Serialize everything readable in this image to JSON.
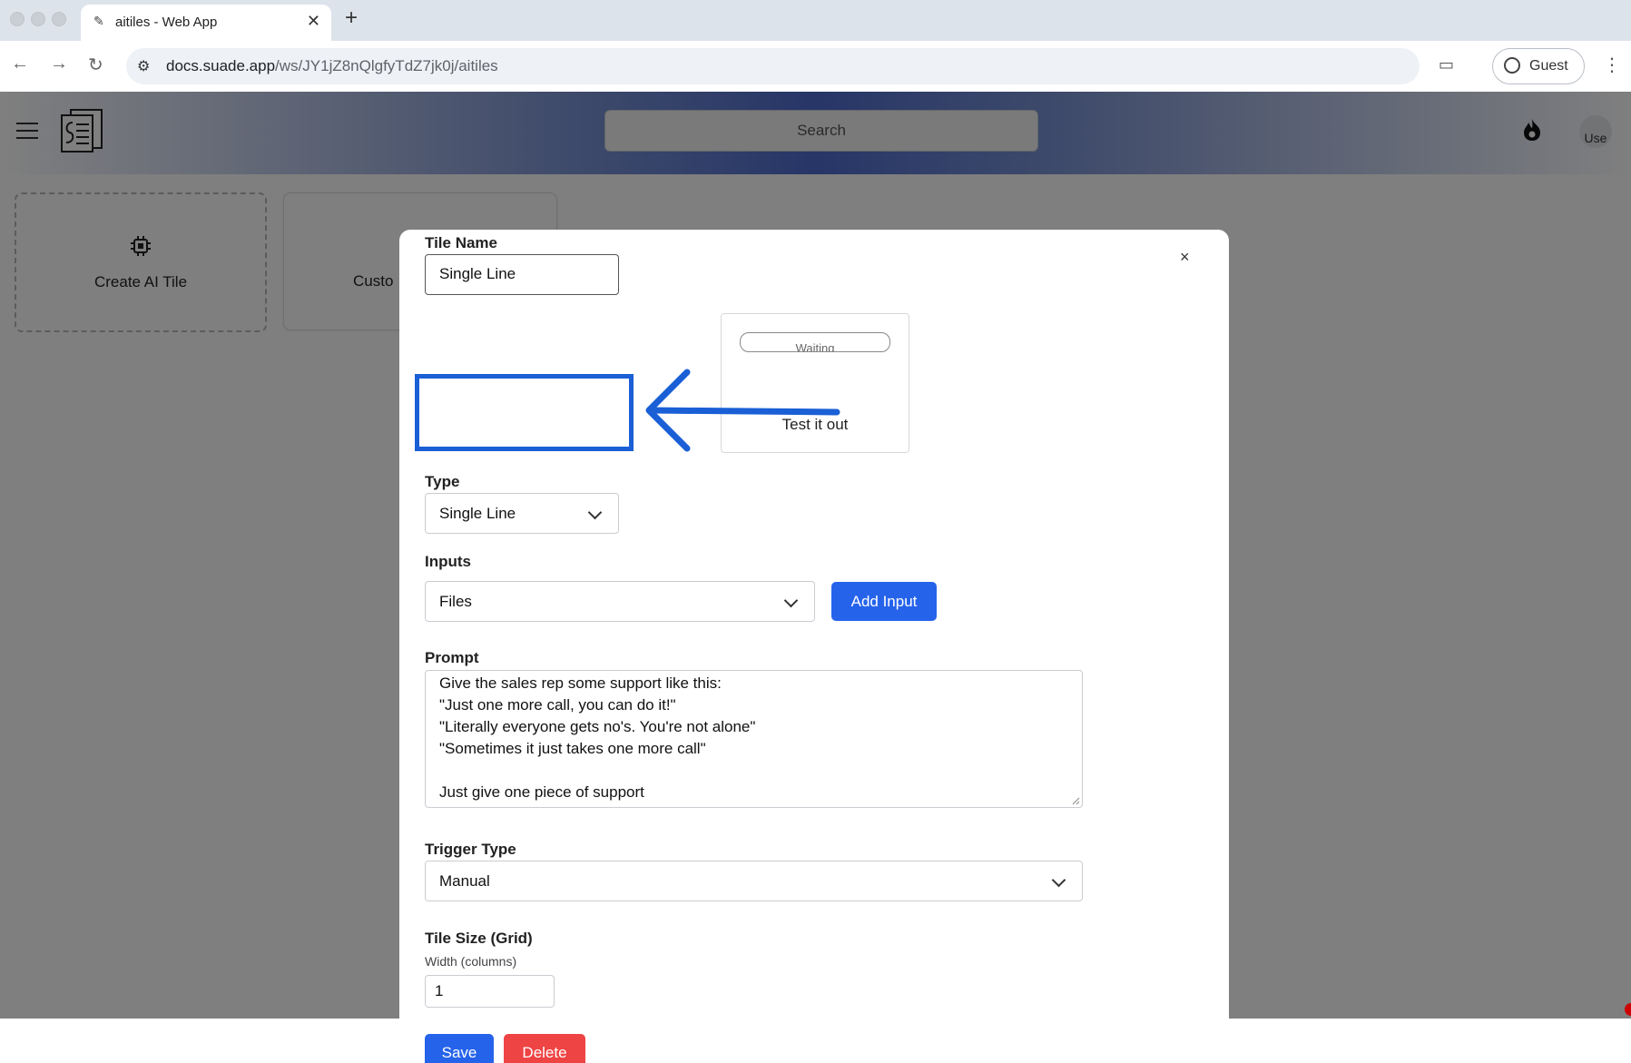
{
  "browser": {
    "tab_title": "aitiles - Web App",
    "url_host": "docs.suade.app",
    "url_path": "/ws/JY1jZ8nQlgfyTdZ7jk0j/aitiles",
    "profile_label": "Guest"
  },
  "app": {
    "search_label": "Search",
    "avatar_text": "Use",
    "cards": [
      {
        "label": "Create AI Tile",
        "icon": "chip-icon"
      },
      {
        "label": "Custo",
        "icon": ""
      }
    ]
  },
  "modal": {
    "tile_name_label": "Tile Name",
    "tile_name_value": "Single Line",
    "preview_status": "Waiting",
    "preview_button": "Test it out",
    "type_label": "Type",
    "type_value": "Single Line",
    "inputs_label": "Inputs",
    "inputs_value": "Files",
    "add_input_label": "Add Input",
    "prompt_label": "Prompt",
    "prompt_lines": [
      "Give the sales rep some support like this:",
      "\"Just one more call, you can do it!\"",
      "\"Literally everyone gets no's. You're not alone\"",
      "\"Sometimes it just takes one more call\"",
      "",
      "Just give one piece of support"
    ],
    "trigger_type_label": "Trigger Type",
    "trigger_type_value": "Manual",
    "tile_size_label": "Tile Size (Grid)",
    "width_label": "Width (columns)",
    "width_value": "1",
    "save_label": "Save",
    "delete_label": "Delete",
    "close_glyph": "×"
  },
  "colors": {
    "primary": "#2563eb",
    "danger": "#ef4444",
    "annotation": "#1a5fd6"
  }
}
